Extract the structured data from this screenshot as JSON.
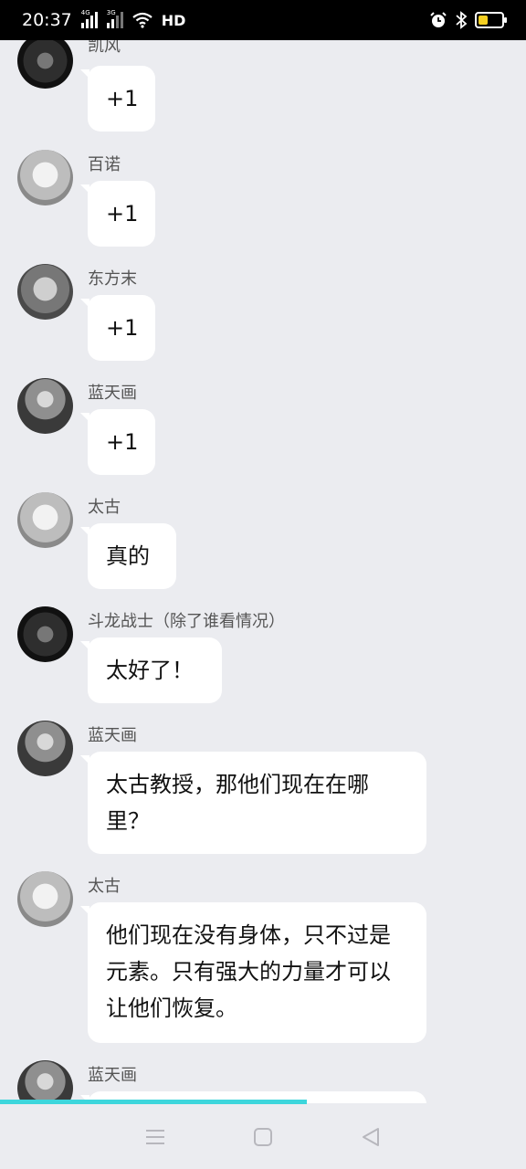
{
  "status_bar": {
    "time": "20:37",
    "network_1": "4G",
    "network_2": "3G",
    "hd_label": "HD",
    "battery_color": "#f5d022",
    "icons": [
      "signal-icon",
      "wifi-icon",
      "alarm-icon",
      "bluetooth-icon",
      "battery-icon"
    ]
  },
  "messages": [
    {
      "sender": "凯风",
      "text": "+1"
    },
    {
      "sender": "百诺",
      "text": "+1"
    },
    {
      "sender": "东方末",
      "text": "+1"
    },
    {
      "sender": "蓝天画",
      "text": "+1"
    },
    {
      "sender": "太古",
      "text": "真的"
    },
    {
      "sender": "斗龙战士（除了谁看情况）",
      "text": "太好了！"
    },
    {
      "sender": "蓝天画",
      "text": "太古教授，那他们现在在哪里？"
    },
    {
      "sender": "太古",
      "text": "他们现在没有身体，只不过是元素。只有强大的力量才可以让他们恢复。"
    },
    {
      "sender": "蓝天画",
      "text": ""
    }
  ],
  "progress_color": "#3dd6dc",
  "nav_bar": {
    "icons": [
      "menu-icon",
      "home-icon",
      "back-icon"
    ]
  }
}
